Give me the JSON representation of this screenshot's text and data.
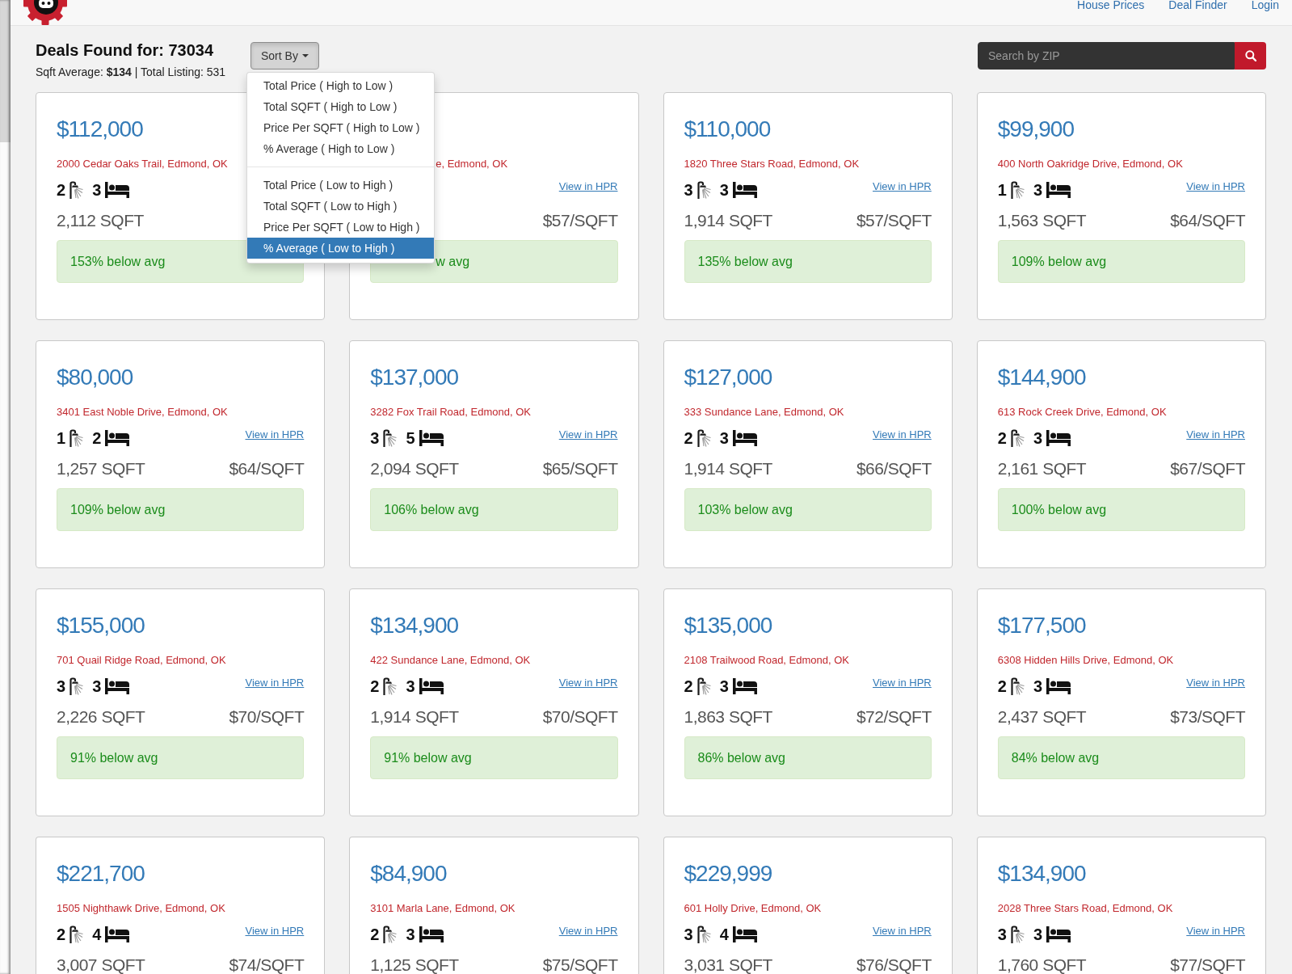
{
  "navbar": {
    "links": [
      "House Prices",
      "Deal Finder",
      "Login"
    ]
  },
  "summary": {
    "title": "Deals Found for: 73034",
    "stats": "Sqft Average: **$134** | Total Listing: 531"
  },
  "sort": {
    "label": "Sort By",
    "expanded": true,
    "groups": [
      {
        "options": [
          {
            "label": "Total Price ( High to Low )",
            "selected": false
          },
          {
            "label": "Total SQFT ( High to Low )",
            "selected": false
          },
          {
            "label": "Price Per SQFT ( High to Low )",
            "selected": false
          },
          {
            "label": "% Average ( High to Low )",
            "selected": false
          }
        ]
      },
      {
        "options": [
          {
            "label": "Total Price ( Low to High )",
            "selected": false
          },
          {
            "label": "Total SQFT ( Low to High )",
            "selected": false
          },
          {
            "label": "Price Per SQFT ( Low to High )",
            "selected": false
          },
          {
            "label": "% Average ( Low to High )",
            "selected": true
          }
        ]
      }
    ]
  },
  "search": {
    "placeholder": "Search by ZIP"
  },
  "listings": [
    {
      "price": "$112,000",
      "address": "2000 Cedar Oaks Trail, Edmond, OK",
      "baths": "2",
      "beds": "3",
      "sqft": "2,112 SQFT",
      "below_avg": "153% below avg"
    },
    {
      "address": "e, Edmond, OK",
      "link": "View in HPR",
      "price_per_sqft": "$57/SQFT",
      "below_avg": "w avg"
    },
    {
      "price": "$110,000",
      "address": "1820 Three Stars Road, Edmond, OK",
      "baths": "3",
      "beds": "3",
      "link": "View in HPR",
      "sqft": "1,914 SQFT",
      "price_per_sqft": "$57/SQFT",
      "below_avg": "135% below avg"
    },
    {
      "price": "$99,900",
      "address": "400 North Oakridge Drive, Edmond, OK",
      "baths": "1",
      "beds": "3",
      "link": "View in HPR",
      "sqft": "1,563 SQFT",
      "price_per_sqft": "$64/SQFT",
      "below_avg": "109% below avg"
    },
    {
      "price": "$80,000",
      "address": "3401 East Noble Drive, Edmond, OK",
      "baths": "1",
      "beds": "2",
      "link": "View in HPR",
      "sqft": "1,257 SQFT",
      "price_per_sqft": "$64/SQFT",
      "below_avg": "109% below avg"
    },
    {
      "price": "$137,000",
      "address": "3282 Fox Trail Road, Edmond, OK",
      "baths": "3",
      "beds": "5",
      "link": "View in HPR",
      "sqft": "2,094 SQFT",
      "price_per_sqft": "$65/SQFT",
      "below_avg": "106% below avg"
    },
    {
      "price": "$127,000",
      "address": "333 Sundance Lane, Edmond, OK",
      "baths": "2",
      "beds": "3",
      "link": "View in HPR",
      "sqft": "1,914 SQFT",
      "price_per_sqft": "$66/SQFT",
      "below_avg": "103% below avg"
    },
    {
      "price": "$144,900",
      "address": "613 Rock Creek Drive, Edmond, OK",
      "baths": "2",
      "beds": "3",
      "link": "View in HPR",
      "sqft": "2,161 SQFT",
      "price_per_sqft": "$67/SQFT",
      "below_avg": "100% below avg"
    },
    {
      "price": "$155,000",
      "address": "701 Quail Ridge Road, Edmond, OK",
      "baths": "3",
      "beds": "3",
      "link": "View in HPR",
      "sqft": "2,226 SQFT",
      "price_per_sqft": "$70/SQFT",
      "below_avg": "91% below avg"
    },
    {
      "price": "$134,900",
      "address": "422 Sundance Lane, Edmond, OK",
      "baths": "2",
      "beds": "3",
      "link": "View in HPR",
      "sqft": "1,914 SQFT",
      "price_per_sqft": "$70/SQFT",
      "below_avg": "91% below avg"
    },
    {
      "price": "$135,000",
      "address": "2108 Trailwood Road, Edmond, OK",
      "baths": "2",
      "beds": "3",
      "link": "View in HPR",
      "sqft": "1,863 SQFT",
      "price_per_sqft": "$72/SQFT",
      "below_avg": "86% below avg"
    },
    {
      "price": "$177,500",
      "address": "6308 Hidden Hills Drive, Edmond, OK",
      "baths": "2",
      "beds": "3",
      "link": "View in HPR",
      "sqft": "2,437 SQFT",
      "price_per_sqft": "$73/SQFT",
      "below_avg": "84% below avg"
    },
    {
      "price": "$221,700",
      "address": "1505 Nighthawk Drive, Edmond, OK",
      "baths": "2",
      "beds": "4",
      "link": "View in HPR",
      "sqft": "3,007 SQFT",
      "price_per_sqft": "$74/SQFT"
    },
    {
      "price": "$84,900",
      "address": "3101 Marla Lane, Edmond, OK",
      "baths": "2",
      "beds": "3",
      "link": "View in HPR",
      "sqft": "1,125 SQFT",
      "price_per_sqft": "$75/SQFT"
    },
    {
      "price": "$229,999",
      "address": "601 Holly Drive, Edmond, OK",
      "baths": "3",
      "beds": "4",
      "link": "View in HPR",
      "sqft": "3,031 SQFT",
      "price_per_sqft": "$76/SQFT"
    },
    {
      "price": "$134,900",
      "address": "2028 Three Stars Road, Edmond, OK",
      "baths": "3",
      "beds": "3",
      "link": "View in HPR",
      "sqft": "1,760 SQFT",
      "price_per_sqft": "$77/SQFT"
    }
  ]
}
